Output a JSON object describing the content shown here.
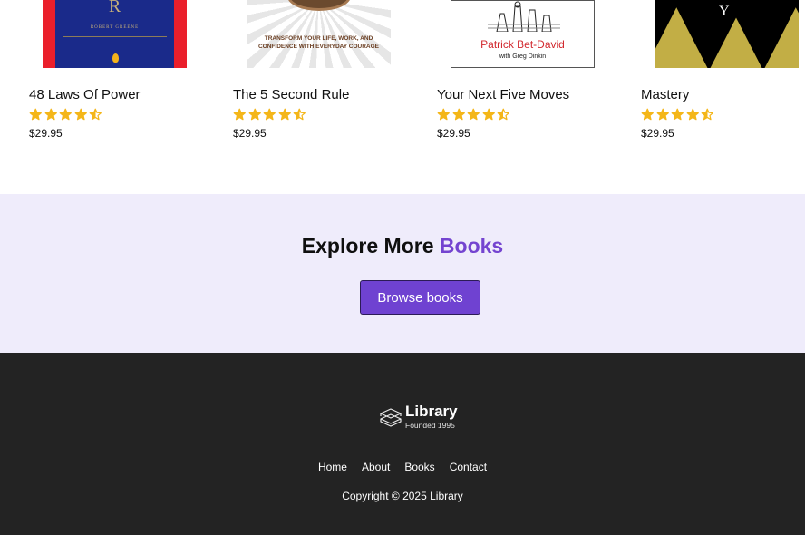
{
  "books": [
    {
      "title": "48 Laws Of Power",
      "price": "$29.95",
      "rating": 4.5,
      "cover": {
        "letter": "R",
        "author": "ROBERT GREENE"
      }
    },
    {
      "title": "The 5 Second Rule",
      "price": "$29.95",
      "rating": 4.5,
      "cover": {
        "tagline": "TRANSFORM YOUR LIFE, WORK, AND CONFIDENCE WITH EVERYDAY COURAGE"
      }
    },
    {
      "title": "Your Next Five Moves",
      "price": "$29.95",
      "rating": 4.5,
      "cover": {
        "author": "Patrick Bet-David",
        "coauthor": "with Greg Dinkin"
      }
    },
    {
      "title": "Mastery",
      "price": "$29.95",
      "rating": 4.5,
      "cover": {
        "letter": "Y"
      }
    }
  ],
  "colors": {
    "star": "#f4b619",
    "accent": "#7444d0",
    "button": "#6f42d1",
    "explore_bg": "#efecfb",
    "footer_bg": "#232323"
  },
  "explore": {
    "heading_prefix": "Explore More",
    "heading_accent": "Books",
    "button_label": "Browse books"
  },
  "footer": {
    "brand_name": "Library",
    "brand_sub": "Founded 1995",
    "links": [
      "Home",
      "About",
      "Books",
      "Contact"
    ],
    "copyright": "Copyright © 2025 Library"
  }
}
